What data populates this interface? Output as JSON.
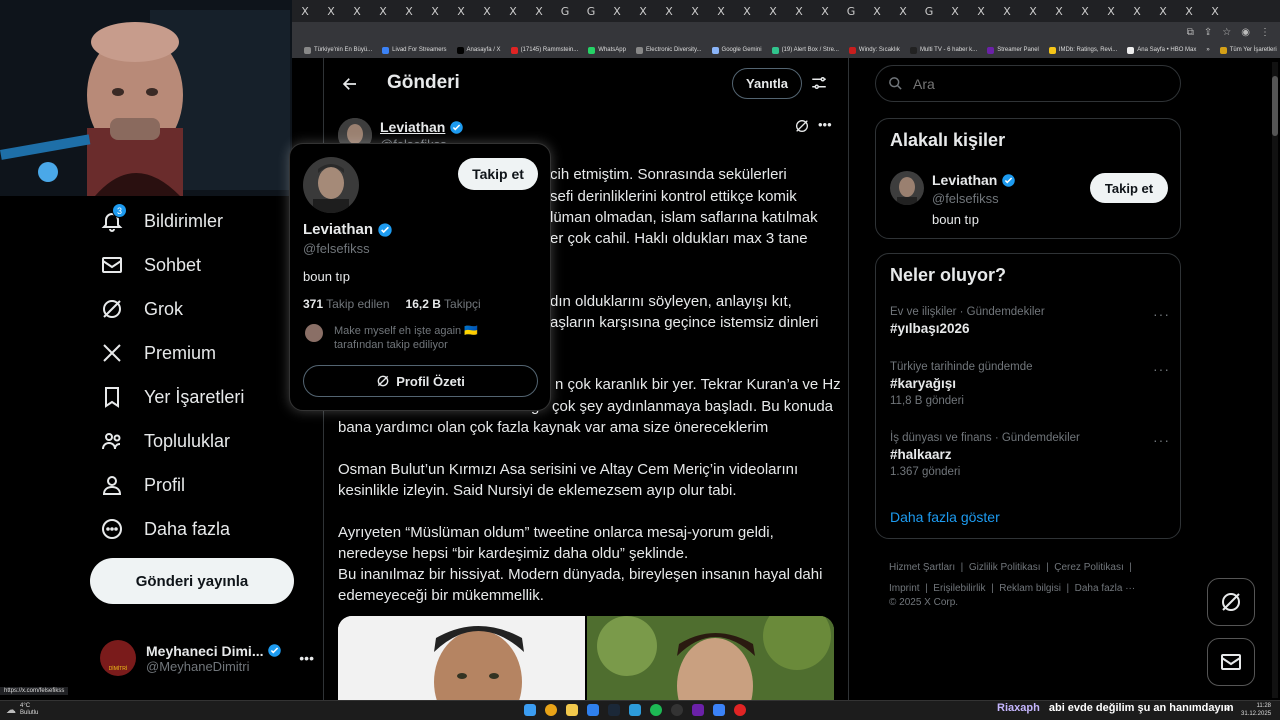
{
  "browser": {
    "tab_glyph": "X",
    "tab_glyph_alt": "G",
    "bookmarks": [
      "Türkiye'nin En Büyü...",
      "Livad For Streamers",
      "Anasayfa / X",
      "(17145) Rammstein...",
      "WhatsApp",
      "Electronic Diversity...",
      "Google Gemini",
      "(19) Alert Box / Stre...",
      "Windy: Sıcaklık",
      "Multi TV - 6 haber k...",
      "Streamer Panel",
      "IMDb: Ratings, Revi...",
      "Ana Sayfa • HBO Max",
      "Tüm Yer İşaretleri"
    ],
    "status_url": "https://x.com/felsefikss"
  },
  "nav": {
    "notifications": {
      "label": "Bildirimler",
      "badge": "3"
    },
    "messages": {
      "label": "Sohbet"
    },
    "grok": {
      "label": "Grok"
    },
    "premium": {
      "label": "Premium"
    },
    "bookmarks": {
      "label": "Yer İşaretleri"
    },
    "communities": {
      "label": "Topluluklar"
    },
    "profile": {
      "label": "Profil"
    },
    "more": {
      "label": "Daha fazla"
    },
    "post_button": "Gönderi yayınla"
  },
  "account": {
    "name": "Meyhaneci Dimi...",
    "handle": "@MeyhaneDimitri",
    "avatar_text": "DİMİTRİ"
  },
  "main": {
    "header_title": "Gönderi",
    "reply_button": "Yanıtla",
    "author_name": "Leviathan",
    "author_handle": "@felsefikss",
    "tweet_lines": [
      "cih etmiştim. Sonrasında sekülerleri",
      "sefi derinliklerini kontrol ettikçe komik",
      "lüman olmadan, islam saflarına katılmak",
      "er çok cahil. Haklı oldukları max 3 tane",
      "dın olduklarını söyleyen, anlayışı kıt,",
      "aşların karşısına geçince istemsiz dinleri",
      "n çok karanlık bir yer. Tekrar Kuran’a ve Hz",
      "çok şey aydınlanmaya başladı. Bu konuda",
      "bana yardımcı olan çok fazla kaynak var ama size önereceklerim",
      "Osman Bulut’un Kırmızı Asa serisini ve Altay Cem Meriç’in videolarını",
      "kesinlikle izleyin. Said Nursiyi de eklemezsem ayıp olur tabi.",
      "Ayrıyeten “Müslüman oldum” tweetine onlarca mesaj-yorum geldi,",
      "neredeyse hepsi “bir kardeşimiz daha oldu” şeklinde.",
      "Bu inanılmaz bir hissiyat. Modern dünyada, bireyleşen insanın hayal dahi",
      "edemeyeceği bir mükemmellik."
    ],
    "tweet_fragment": "g"
  },
  "hovercard": {
    "follow_button": "Takip et",
    "name": "Leviathan",
    "handle": "@felsefikss",
    "bio": "boun tıp",
    "following_count": "371",
    "following_label": "Takip edilen",
    "followers_count": "16,2 B",
    "followers_label": "Takipçi",
    "followed_by_line1": "Make myself eh işte again 🇺🇦",
    "followed_by_line2": "tarafından takip ediliyor",
    "profile_summary_button": "Profil Özeti"
  },
  "search": {
    "placeholder": "Ara"
  },
  "related": {
    "title": "Alakalı kişiler",
    "name": "Leviathan",
    "handle": "@felsefikss",
    "bio": "boun tıp",
    "follow_button": "Takip et"
  },
  "trends": {
    "title": "Neler oluyor?",
    "items": [
      {
        "context": "Ev ve ilişkiler · Gündemdekiler",
        "name": "#yılbaşı2026",
        "count": ""
      },
      {
        "context": "Türkiye tarihinde gündemde",
        "name": "#karyağışı",
        "count": "11,8 B gönderi"
      },
      {
        "context": "İş dünyası ve finans · Gündemdekiler",
        "name": "#halkaarz",
        "count": "1.367 gönderi"
      }
    ],
    "more_options": "···",
    "show_more": "Daha fazla göster"
  },
  "footer": {
    "links": [
      "Hizmet Şartları",
      "Gizlilik Politikası",
      "Çerez Politikası",
      "Imprint",
      "Erişilebilirlik",
      "Reklam bilgisi",
      "Daha fazla ···"
    ],
    "copyright": "© 2025 X Corp."
  },
  "taskbar": {
    "weather_temp": "4°C",
    "weather_desc": "Bulutlu",
    "chat_user": "Riaxaph",
    "chat_message": "abi evde değilim şu an hanımdayım",
    "time": "11:28",
    "date": "31.12.2025"
  },
  "colors": {
    "accent": "#1d9bf0",
    "verified": "#1d9bf0",
    "bg": "#000000",
    "text": "#e7e9ea",
    "muted": "#71767b"
  }
}
